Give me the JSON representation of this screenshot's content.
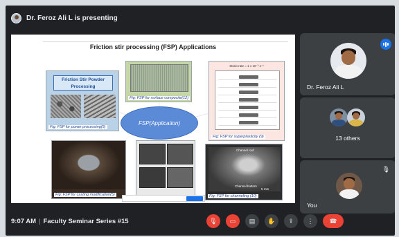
{
  "header": {
    "presenting_text": "Dr. Feroz Ali L is presenting"
  },
  "slide": {
    "title": "Friction stir processing (FSP) Applications",
    "center_label": "FSP(Application)",
    "panels": {
      "power": {
        "title": "Friction Stir Powder Processing",
        "caption": "Fig: FSP for power processing(5)"
      },
      "surface": {
        "caption": "Fig: FSP for surface composite(12)"
      },
      "superplastic": {
        "header": "Strain rate = 1 x 10⁻² s⁻¹",
        "caption": "Fig: FSP for superplasticity (9)"
      },
      "casting": {
        "caption": "Fig: FSP for casting modification(5)"
      },
      "channeling": {
        "roof_label": "Channel roof",
        "bottom_label": "Channel bottom",
        "scale_label": "5 mm",
        "caption": "Fig: FSP for channeling (10)"
      }
    }
  },
  "participants": [
    {
      "name": "Dr. Feroz Ali L",
      "speaking": true
    },
    {
      "name": "13 others"
    },
    {
      "name": "You",
      "muted": true
    }
  ],
  "footer": {
    "time": "9:07 AM",
    "meeting_title": "Faculty Seminar Series #15"
  },
  "colors": {
    "end_call": "#ea4335",
    "accent": "#1a73e8",
    "background": "#202124"
  }
}
